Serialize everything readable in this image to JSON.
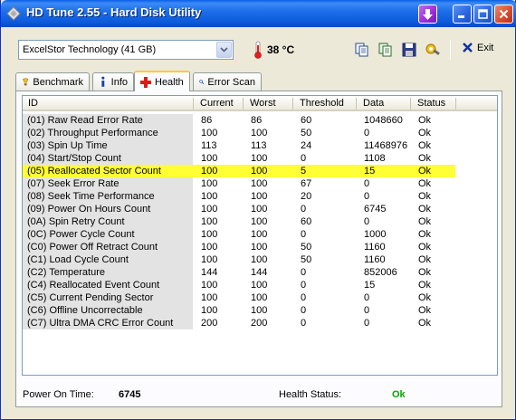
{
  "window": {
    "title": "HD Tune 2.55 - Hard Disk Utility"
  },
  "toolbar": {
    "drive_selected": "ExcelStor Technology (41 GB)",
    "temperature": "38 °C",
    "exit_label": "Exit"
  },
  "tabs": [
    {
      "label": "Benchmark",
      "icon": "benchmark-icon"
    },
    {
      "label": "Info",
      "icon": "info-icon"
    },
    {
      "label": "Health",
      "icon": "health-icon"
    },
    {
      "label": "Error Scan",
      "icon": "error-scan-icon"
    }
  ],
  "active_tab": "Health",
  "table": {
    "columns": [
      "ID",
      "Current",
      "Worst",
      "Threshold",
      "Data",
      "Status"
    ],
    "rows": [
      {
        "id": "(01) Raw Read Error Rate",
        "current": "86",
        "worst": "86",
        "threshold": "60",
        "data": "1048660",
        "status": "Ok"
      },
      {
        "id": "(02) Throughput Performance",
        "current": "100",
        "worst": "100",
        "threshold": "50",
        "data": "0",
        "status": "Ok"
      },
      {
        "id": "(03) Spin Up Time",
        "current": "113",
        "worst": "113",
        "threshold": "24",
        "data": "11468976",
        "status": "Ok"
      },
      {
        "id": "(04) Start/Stop Count",
        "current": "100",
        "worst": "100",
        "threshold": "0",
        "data": "1108",
        "status": "Ok"
      },
      {
        "id": "(05) Reallocated Sector Count",
        "current": "100",
        "worst": "100",
        "threshold": "5",
        "data": "15",
        "status": "Ok",
        "highlight": true
      },
      {
        "id": "(07) Seek Error Rate",
        "current": "100",
        "worst": "100",
        "threshold": "67",
        "data": "0",
        "status": "Ok"
      },
      {
        "id": "(08) Seek Time Performance",
        "current": "100",
        "worst": "100",
        "threshold": "20",
        "data": "0",
        "status": "Ok"
      },
      {
        "id": "(09) Power On Hours Count",
        "current": "100",
        "worst": "100",
        "threshold": "0",
        "data": "6745",
        "status": "Ok"
      },
      {
        "id": "(0A) Spin Retry Count",
        "current": "100",
        "worst": "100",
        "threshold": "60",
        "data": "0",
        "status": "Ok"
      },
      {
        "id": "(0C) Power Cycle Count",
        "current": "100",
        "worst": "100",
        "threshold": "0",
        "data": "1000",
        "status": "Ok"
      },
      {
        "id": "(C0) Power Off Retract Count",
        "current": "100",
        "worst": "100",
        "threshold": "50",
        "data": "1160",
        "status": "Ok"
      },
      {
        "id": "(C1) Load Cycle Count",
        "current": "100",
        "worst": "100",
        "threshold": "50",
        "data": "1160",
        "status": "Ok"
      },
      {
        "id": "(C2) Temperature",
        "current": "144",
        "worst": "144",
        "threshold": "0",
        "data": "852006",
        "status": "Ok"
      },
      {
        "id": "(C4) Reallocated Event Count",
        "current": "100",
        "worst": "100",
        "threshold": "0",
        "data": "15",
        "status": "Ok"
      },
      {
        "id": "(C5) Current Pending Sector",
        "current": "100",
        "worst": "100",
        "threshold": "0",
        "data": "0",
        "status": "Ok"
      },
      {
        "id": "(C6) Offline Uncorrectable",
        "current": "100",
        "worst": "100",
        "threshold": "0",
        "data": "0",
        "status": "Ok"
      },
      {
        "id": "(C7) Ultra DMA CRC Error Count",
        "current": "200",
        "worst": "200",
        "threshold": "0",
        "data": "0",
        "status": "Ok"
      }
    ]
  },
  "footer": {
    "power_on_label": "Power On Time:",
    "power_on_value": "6745",
    "health_label": "Health Status:",
    "health_value": "Ok"
  },
  "colors": {
    "highlight_row": "#FFFF33",
    "health_ok": "#00AA00",
    "title_bar": "#0A5FE8"
  }
}
